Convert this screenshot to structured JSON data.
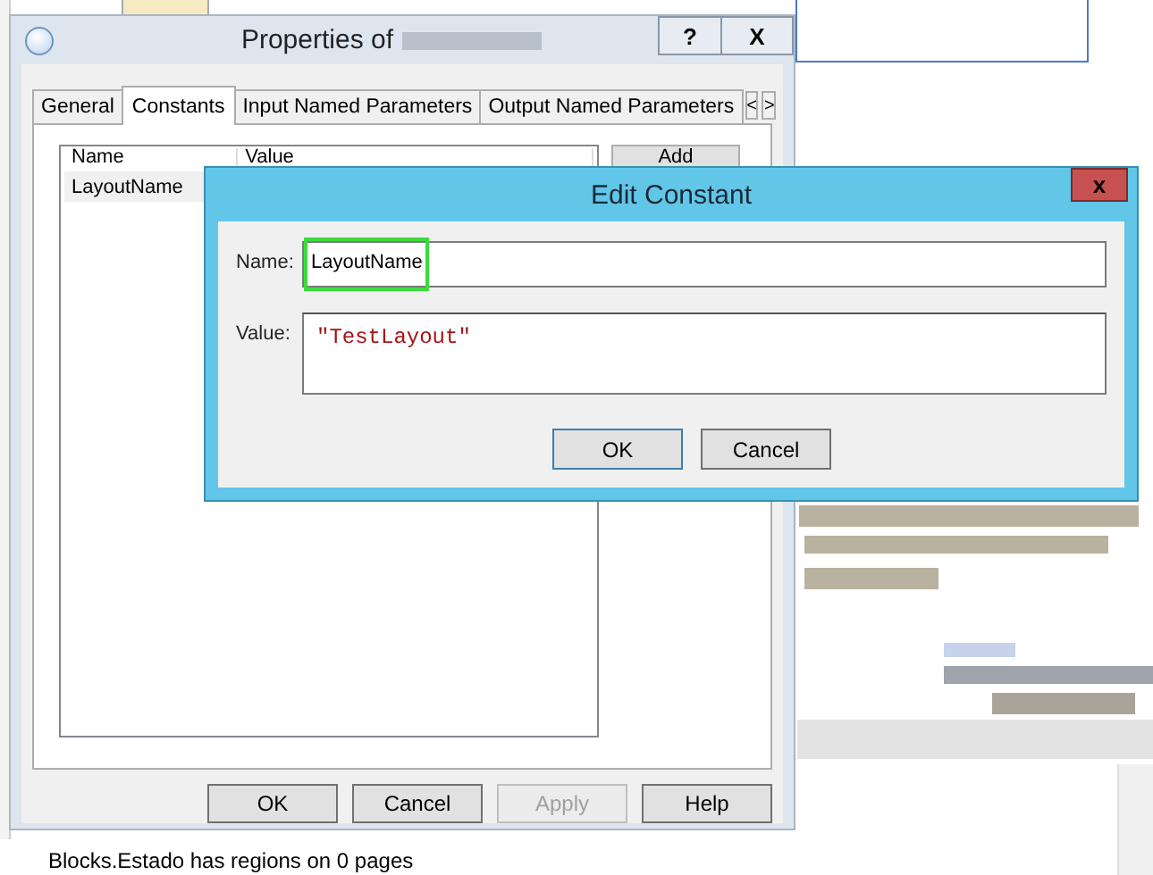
{
  "background_app": {
    "status_text": "Blocks.Estado has regions on 0 pages"
  },
  "properties_window": {
    "title": "Properties of",
    "help_button": "?",
    "close_button": "X",
    "tabs": [
      {
        "label": "General",
        "selected": false
      },
      {
        "label": "Constants",
        "selected": true
      },
      {
        "label": "Input Named Parameters",
        "selected": false
      },
      {
        "label": "Output Named Parameters",
        "selected": false
      }
    ],
    "tab_scroll_buttons": [
      "<",
      ">"
    ],
    "list": {
      "columns": [
        "Name",
        "Value"
      ],
      "rows": [
        {
          "name": "LayoutName",
          "selected": true
        }
      ]
    },
    "side_buttons": [
      "Add"
    ],
    "buttons": [
      {
        "label": "OK",
        "disabled": false
      },
      {
        "label": "Cancel",
        "disabled": false
      },
      {
        "label": "Apply",
        "disabled": true
      },
      {
        "label": "Help",
        "disabled": false
      }
    ]
  },
  "edit_dialog": {
    "title": "Edit Constant",
    "close_button": "x",
    "fields": [
      {
        "kind": "text",
        "label": "Name:",
        "value": "LayoutName",
        "highlighted": true
      },
      {
        "kind": "multiline",
        "label": "Value:",
        "value": "\"TestLayout\"",
        "highlighted": false
      }
    ],
    "buttons": [
      "OK",
      "Cancel"
    ]
  }
}
